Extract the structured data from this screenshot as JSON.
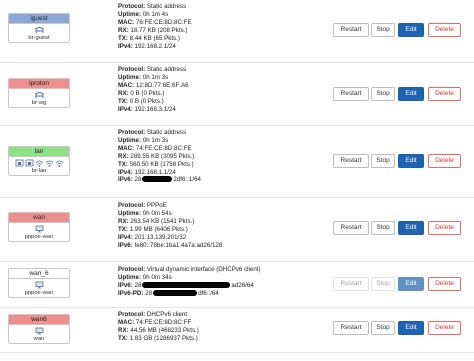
{
  "buttons": {
    "restart": "Restart",
    "stop": "Stop",
    "edit": "Edit",
    "delete": "Delete"
  },
  "labels": {
    "protocol": "Protocol:",
    "uptime": "Uptime:",
    "mac": "MAC:",
    "rx": "RX:",
    "tx": "TX:",
    "ipv4": "IPv4:",
    "ipv6": "IPv6:",
    "ipv6pd": "IPv6-PD:"
  },
  "colors": {
    "zone_guest": "#8aa9d9",
    "zone_red": "#ee8f8f",
    "zone_green": "#90e08a",
    "edit": "#1f62b0",
    "delete_text": "#d23a3a"
  },
  "interfaces": [
    {
      "name": "iguest",
      "device": "br-guest",
      "zone_color": "#8aa9d9",
      "icons": [
        "bridge-icon"
      ],
      "protocol": "Static address",
      "uptime": "0h 1m 4s",
      "mac": "76:FE:CE:8D:8C:FE",
      "rx": "18.77 KB (208 Pkts.)",
      "tx": "8.44 KB (65 Pkts.)",
      "ipv4": "192.168.2.1/24"
    },
    {
      "name": "iproton",
      "device": "br-wg",
      "zone_color": "#ee8f8f",
      "icons": [
        "bridge-icon"
      ],
      "protocol": "Static address",
      "uptime": "0h 1m 3s",
      "mac": "12:8D:77:6E:6F:A6",
      "rx": "0 B (0 Pkts.)",
      "tx": "0 B (0 Pkts.)",
      "ipv4": "192.168.3.1/24"
    },
    {
      "name": "lan",
      "device": "br-lan",
      "zone_color": "#90e08a",
      "icons": [
        "ethernet-port-icon",
        "ethernet-port-icon",
        "wifi-icon",
        "wifi-icon",
        "wifi-icon"
      ],
      "protocol": "Static address",
      "uptime": "0h 1m 3s",
      "mac": "74:FE:CE:8D:8C:FE",
      "rx": "289.55 KB (3095 Pkts.)",
      "tx": "560.50 KB (1758 Pkts.)",
      "ipv4": "192.168.1.1/24",
      "ipv6_prefix": "28",
      "ipv6_suffix": "2df6::1/64"
    },
    {
      "name": "wan",
      "device": "pppoe-wan",
      "zone_color": "#ee8f8f",
      "icons": [
        "network-device-icon"
      ],
      "protocol": "PPPoE",
      "uptime": "0h 0m 54s",
      "rx": "263.54 KB (1541 Pkts.)",
      "tx": "1.99 MB (6406 Pkts.)",
      "ipv4": "201.13.139.201/32",
      "ipv6": "fe80::78be:1ba1:4a7a:ad26/128"
    },
    {
      "name": "wan_6",
      "device": "pppoe-wan",
      "zone_color": "#ee8f8f",
      "icons": [
        "network-device-icon"
      ],
      "protocol": "Virtual dynamic interface (DHCPv6 client)",
      "uptime": "0h 0m 34s",
      "ipv6_prefix": "28",
      "ipv6_suffix": "ad26/64",
      "ipv6pd_prefix": "28",
      "ipv6pd_suffix": "df6::/64"
    },
    {
      "name": "wan6",
      "device": "wan",
      "zone_color": "#ee8f8f",
      "icons": [
        "network-device-icon"
      ],
      "protocol": "DHCPv6 client",
      "mac": "74:FE:CE:8D:8C:FF",
      "rx": "44.56 MB (468233 Pkts.)",
      "tx": "1.83 GB (1286937 Pkts.)"
    }
  ]
}
